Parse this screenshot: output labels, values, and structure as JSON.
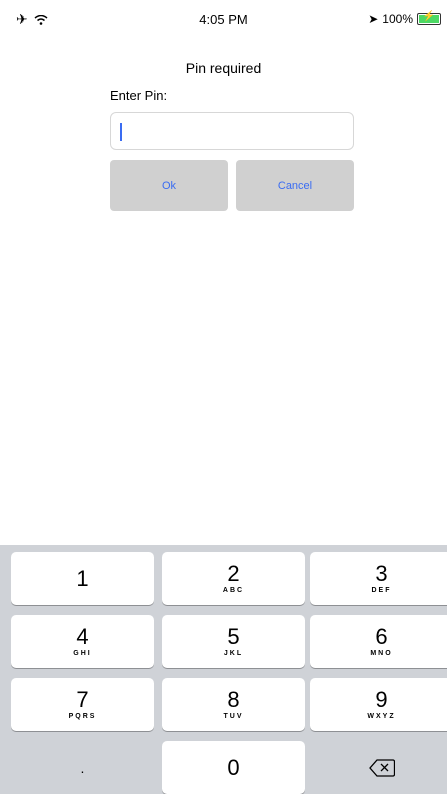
{
  "status_bar": {
    "time": "4:05 PM",
    "battery": "100%"
  },
  "dialog": {
    "title": "Pin required",
    "prompt": "Enter Pin:",
    "pin_value": "",
    "ok_label": "Ok",
    "cancel_label": "Cancel"
  },
  "keypad": {
    "keys": [
      {
        "number": "1",
        "letters": ""
      },
      {
        "number": "2",
        "letters": "ABC"
      },
      {
        "number": "3",
        "letters": "DEF"
      },
      {
        "number": "4",
        "letters": "GHI"
      },
      {
        "number": "5",
        "letters": "JKL"
      },
      {
        "number": "6",
        "letters": "MNO"
      },
      {
        "number": "7",
        "letters": "PQRS"
      },
      {
        "number": "8",
        "letters": "TUV"
      },
      {
        "number": "9",
        "letters": "WXYZ"
      },
      {
        "number": ".",
        "letters": ""
      },
      {
        "number": "0",
        "letters": ""
      }
    ]
  },
  "colors": {
    "accent": "#3a6cf2",
    "button_bg": "#d0d0d0",
    "keypad_bg": "#cfd2d7"
  }
}
